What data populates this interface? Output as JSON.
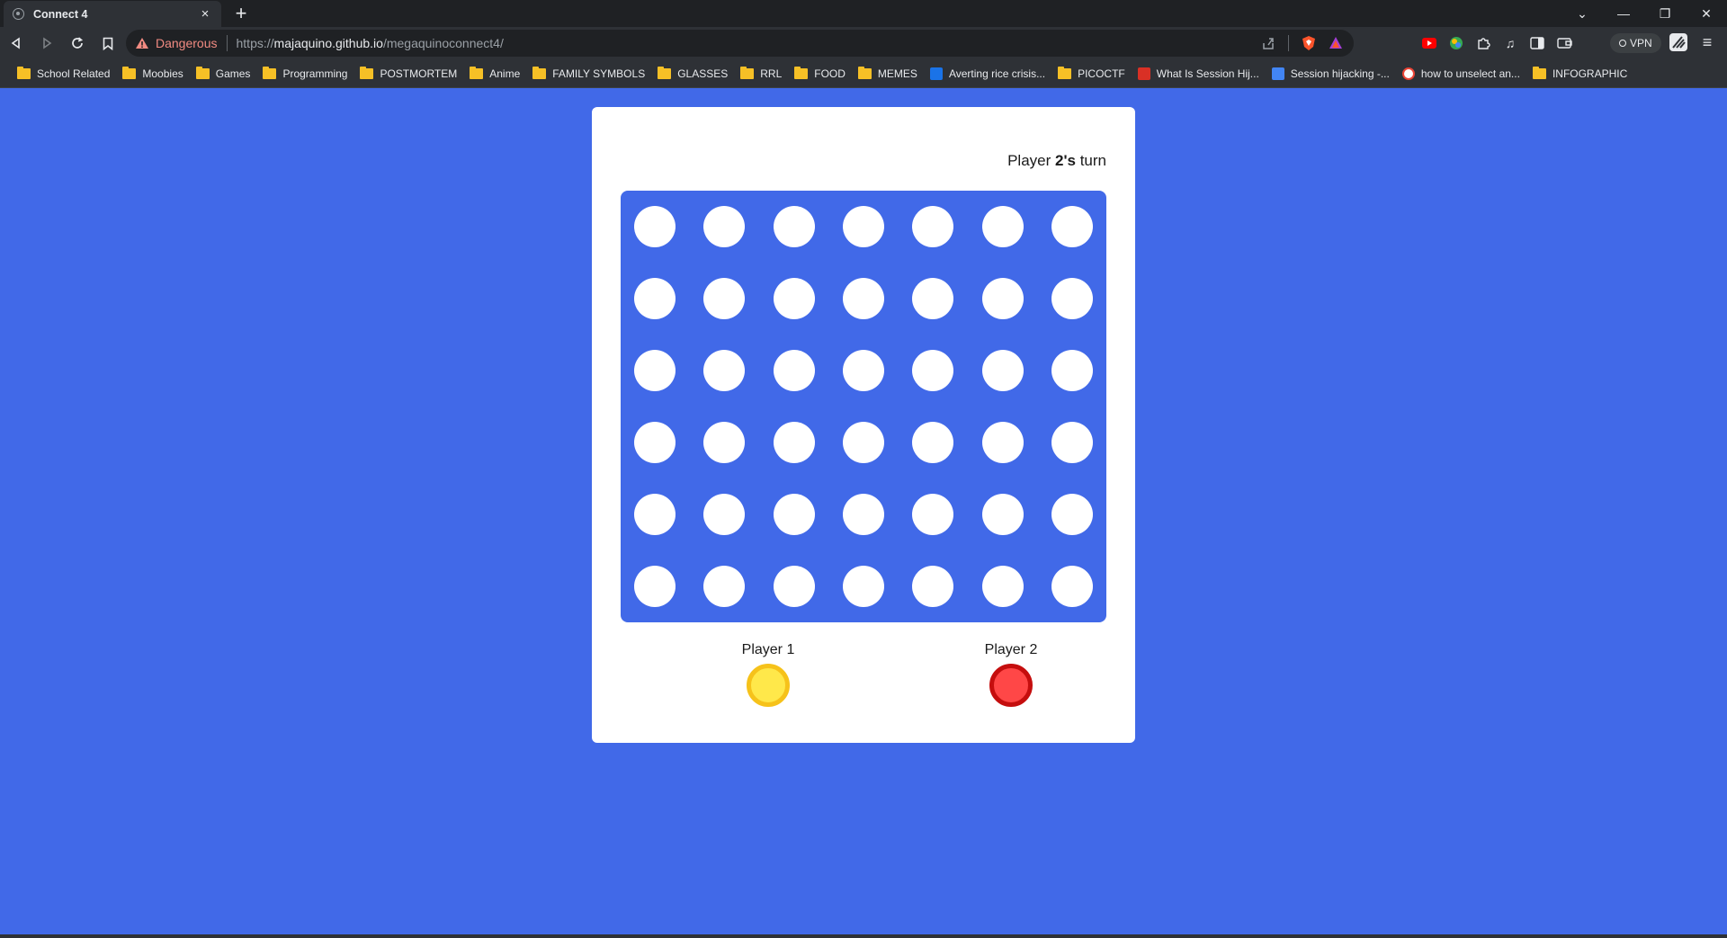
{
  "browser": {
    "tab_title": "Connect 4",
    "tab_close": "×",
    "new_tab": "+",
    "security_label": "Dangerous",
    "url_scheme": "https://",
    "url_host": "majaquino.github.io",
    "url_path": "/megaquinoconnect4/",
    "vpn_label": "VPN",
    "bookmarks": [
      {
        "label": "School Related",
        "icon": "folder-icon"
      },
      {
        "label": "Moobies",
        "icon": "folder-icon"
      },
      {
        "label": "Games",
        "icon": "folder-icon"
      },
      {
        "label": "Programming",
        "icon": "folder-icon"
      },
      {
        "label": "POSTMORTEM",
        "icon": "folder-icon"
      },
      {
        "label": "Anime",
        "icon": "folder-icon"
      },
      {
        "label": "FAMILY SYMBOLS",
        "icon": "folder-icon"
      },
      {
        "label": "GLASSES",
        "icon": "folder-icon"
      },
      {
        "label": "RRL",
        "icon": "folder-icon"
      },
      {
        "label": "FOOD",
        "icon": "folder-icon"
      },
      {
        "label": "MEMES",
        "icon": "folder-icon"
      },
      {
        "label": "Averting rice crisis...",
        "icon": "site-icon"
      },
      {
        "label": "PICOCTF",
        "icon": "folder-icon"
      },
      {
        "label": "What Is Session Hij...",
        "icon": "site-icon"
      },
      {
        "label": "Session hijacking -...",
        "icon": "docs-icon"
      },
      {
        "label": "how to unselect an...",
        "icon": "google-icon"
      },
      {
        "label": "INFOGRAPHIC",
        "icon": "folder-icon"
      }
    ]
  },
  "game": {
    "turn_prefix": "Player ",
    "turn_player": "2's",
    "turn_suffix": " turn",
    "rows": 6,
    "columns": 7,
    "players": [
      {
        "label": "Player 1",
        "color": "#ffe84a",
        "border": "#f6c21a"
      },
      {
        "label": "Player 2",
        "color": "#ff4747",
        "border": "#c50e0e"
      }
    ],
    "board_color": "#4169e8",
    "empty_cell_color": "#ffffff",
    "page_background": "#4169e8"
  }
}
